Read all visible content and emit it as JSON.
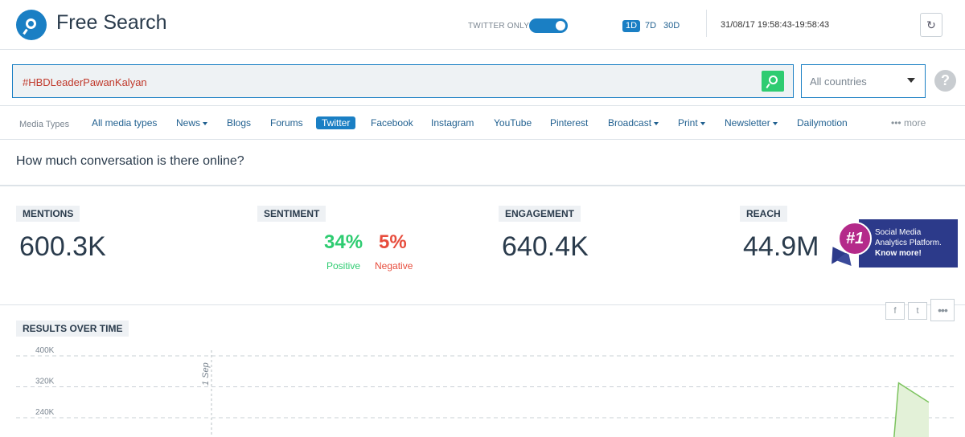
{
  "header": {
    "title": "Free Search",
    "twitter_only_label": "TWITTER ONLY",
    "twitter_only_on": true,
    "ranges": [
      "1D",
      "7D",
      "30D"
    ],
    "active_range": "1D",
    "datetime": "31/08/17 19:58:43-19:58:43"
  },
  "search": {
    "query": "#HBDLeaderPawanKalyan",
    "country": "All countries",
    "help": "?"
  },
  "media": {
    "label": "Media Types",
    "items": [
      {
        "label": "All media types",
        "dropdown": false
      },
      {
        "label": "News",
        "dropdown": true
      },
      {
        "label": "Blogs",
        "dropdown": false
      },
      {
        "label": "Forums",
        "dropdown": false
      },
      {
        "label": "Twitter",
        "dropdown": false,
        "active": true
      },
      {
        "label": "Facebook",
        "dropdown": false
      },
      {
        "label": "Instagram",
        "dropdown": false
      },
      {
        "label": "YouTube",
        "dropdown": false
      },
      {
        "label": "Pinterest",
        "dropdown": false
      },
      {
        "label": "Broadcast",
        "dropdown": true
      },
      {
        "label": "Print",
        "dropdown": true
      },
      {
        "label": "Newsletter",
        "dropdown": true
      },
      {
        "label": "Dailymotion",
        "dropdown": false
      }
    ],
    "more": "••• more"
  },
  "question": "How much conversation is there online?",
  "stats": {
    "mentions": {
      "label": "MENTIONS",
      "value": "600.3K"
    },
    "sentiment": {
      "label": "SENTIMENT",
      "positive_pct": "34%",
      "positive_label": "Positive",
      "negative_pct": "5%",
      "negative_label": "Negative"
    },
    "engagement": {
      "label": "ENGAGEMENT",
      "value": "640.4K"
    },
    "reach": {
      "label": "REACH",
      "value": "44.9M"
    }
  },
  "ad": {
    "badge": "#1",
    "line1": "Social Media",
    "line2": "Analytics Platform.",
    "cta": "Know more!"
  },
  "results": {
    "label": "RESULTS OVER TIME",
    "share": {
      "facebook": "f",
      "twitter": "t",
      "more": "•••"
    }
  },
  "colors": {
    "accent": "#1a7fc4",
    "positive": "#2ecc71",
    "negative": "#e74c3c",
    "chart_fill": "#e3f1d8",
    "chart_line": "#7cc35e"
  },
  "chart_data": {
    "type": "area",
    "y_ticks": [
      "400K",
      "320K",
      "240K"
    ],
    "y_tick_values": [
      400000,
      320000,
      240000
    ],
    "x_marker": "1 Sep",
    "series": [
      {
        "values": [
          {
            "x": 0.0,
            "y": 0
          },
          {
            "x": 0.955,
            "y": 0
          },
          {
            "x": 0.967,
            "y": 330000
          },
          {
            "x": 1.0,
            "y": 280000
          }
        ]
      }
    ],
    "grid": true
  }
}
